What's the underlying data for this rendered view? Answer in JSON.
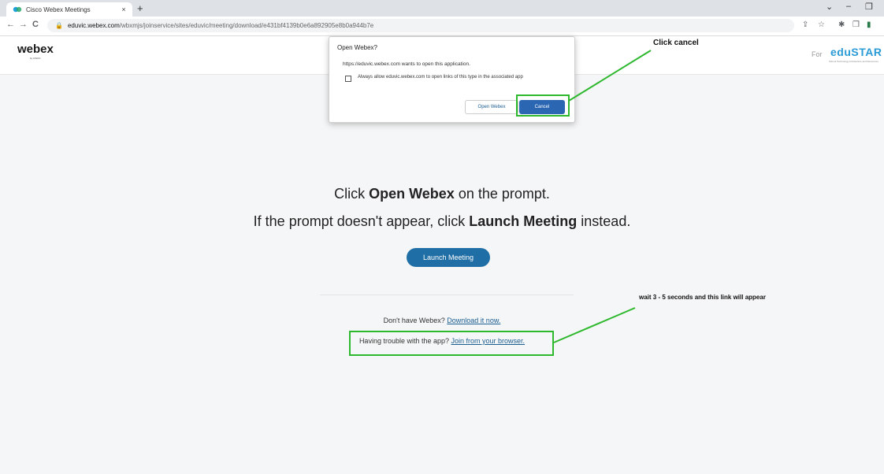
{
  "browser": {
    "tab": {
      "title": "Cisco Webex Meetings",
      "favicon": "webex-favicon",
      "close_glyph": "×"
    },
    "new_tab_glyph": "+",
    "window_controls": {
      "dropdown": "⌄",
      "minimize": "–",
      "restore": "❐"
    },
    "nav": {
      "back": "←",
      "forward": "→",
      "reload": "C"
    },
    "url": {
      "host": "eduvic.webex.com",
      "path": "/wbxmjs/joinservice/sites/eduvic/meeting/download/e431bf4139b0e6a892905e8b0a944b7e"
    },
    "toolbar_icons": {
      "share": "⇪",
      "star": "☆",
      "extensions": "✱",
      "sidepanel": "❒",
      "profile": "▮"
    }
  },
  "site": {
    "logo": "webex",
    "logo_sub": "by CISCO",
    "for_label": "For",
    "partner_logo": "eduSTAR",
    "partner_sub": "School Technology Architecture and Resources"
  },
  "main": {
    "line1": {
      "before": "Click ",
      "bold": "Open Webex",
      "after": " on the prompt."
    },
    "line2": {
      "before": "If the prompt doesn't appear, click ",
      "bold": "Launch Meeting",
      "after": " instead."
    },
    "launch_button": "Launch Meeting",
    "download": {
      "text": "Don't have Webex? ",
      "link": "Download it now."
    },
    "trouble": {
      "text": "Having trouble with the app? ",
      "link": "Join from your browser."
    }
  },
  "dialog": {
    "title": "Open Webex?",
    "message": "https://eduvic.webex.com wants to open this application.",
    "checkbox_label": "Always allow eduvic.webex.com to open links of this type in the associated app",
    "open_button": "Open Webex",
    "cancel_button": "Cancel"
  },
  "annotations": {
    "cancel_note": "Click cancel",
    "link_note": "wait 3 - 5 seconds and this link will appear",
    "color": "#2eb82e"
  }
}
